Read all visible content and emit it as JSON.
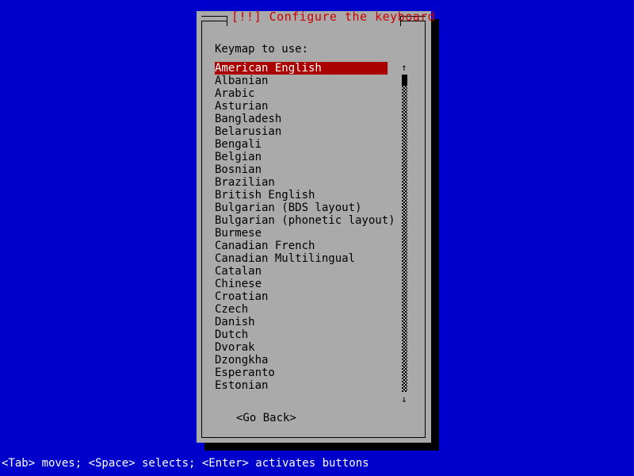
{
  "screen": {
    "background_color": "#0000cc",
    "shadow_color": "#000000"
  },
  "dialog": {
    "title": "[!!] Configure the keyboard",
    "title_color": "#cc0000",
    "background_color": "#aaaaaa",
    "prompt": "Keymap to use:",
    "selected_index": 0,
    "highlight_background": "#aa0000",
    "highlight_foreground": "#ffffff",
    "items": [
      "American English",
      "Albanian",
      "Arabic",
      "Asturian",
      "Bangladesh",
      "Belarusian",
      "Bengali",
      "Belgian",
      "Bosnian",
      "Brazilian",
      "British English",
      "Bulgarian (BDS layout)",
      "Bulgarian (phonetic layout)",
      "Burmese",
      "Canadian French",
      "Canadian Multilingual",
      "Catalan",
      "Chinese",
      "Croatian",
      "Czech",
      "Danish",
      "Dutch",
      "Dvorak",
      "Dzongkha",
      "Esperanto",
      "Estonian"
    ],
    "scrollbar": {
      "up_arrow": "↑",
      "down_arrow": "↓"
    },
    "buttons": {
      "go_back": "<Go Back>"
    }
  },
  "statusbar": {
    "text": "<Tab> moves; <Space> selects; <Enter> activates buttons",
    "background_color": "#0000cc",
    "foreground_color": "#ffffff"
  }
}
